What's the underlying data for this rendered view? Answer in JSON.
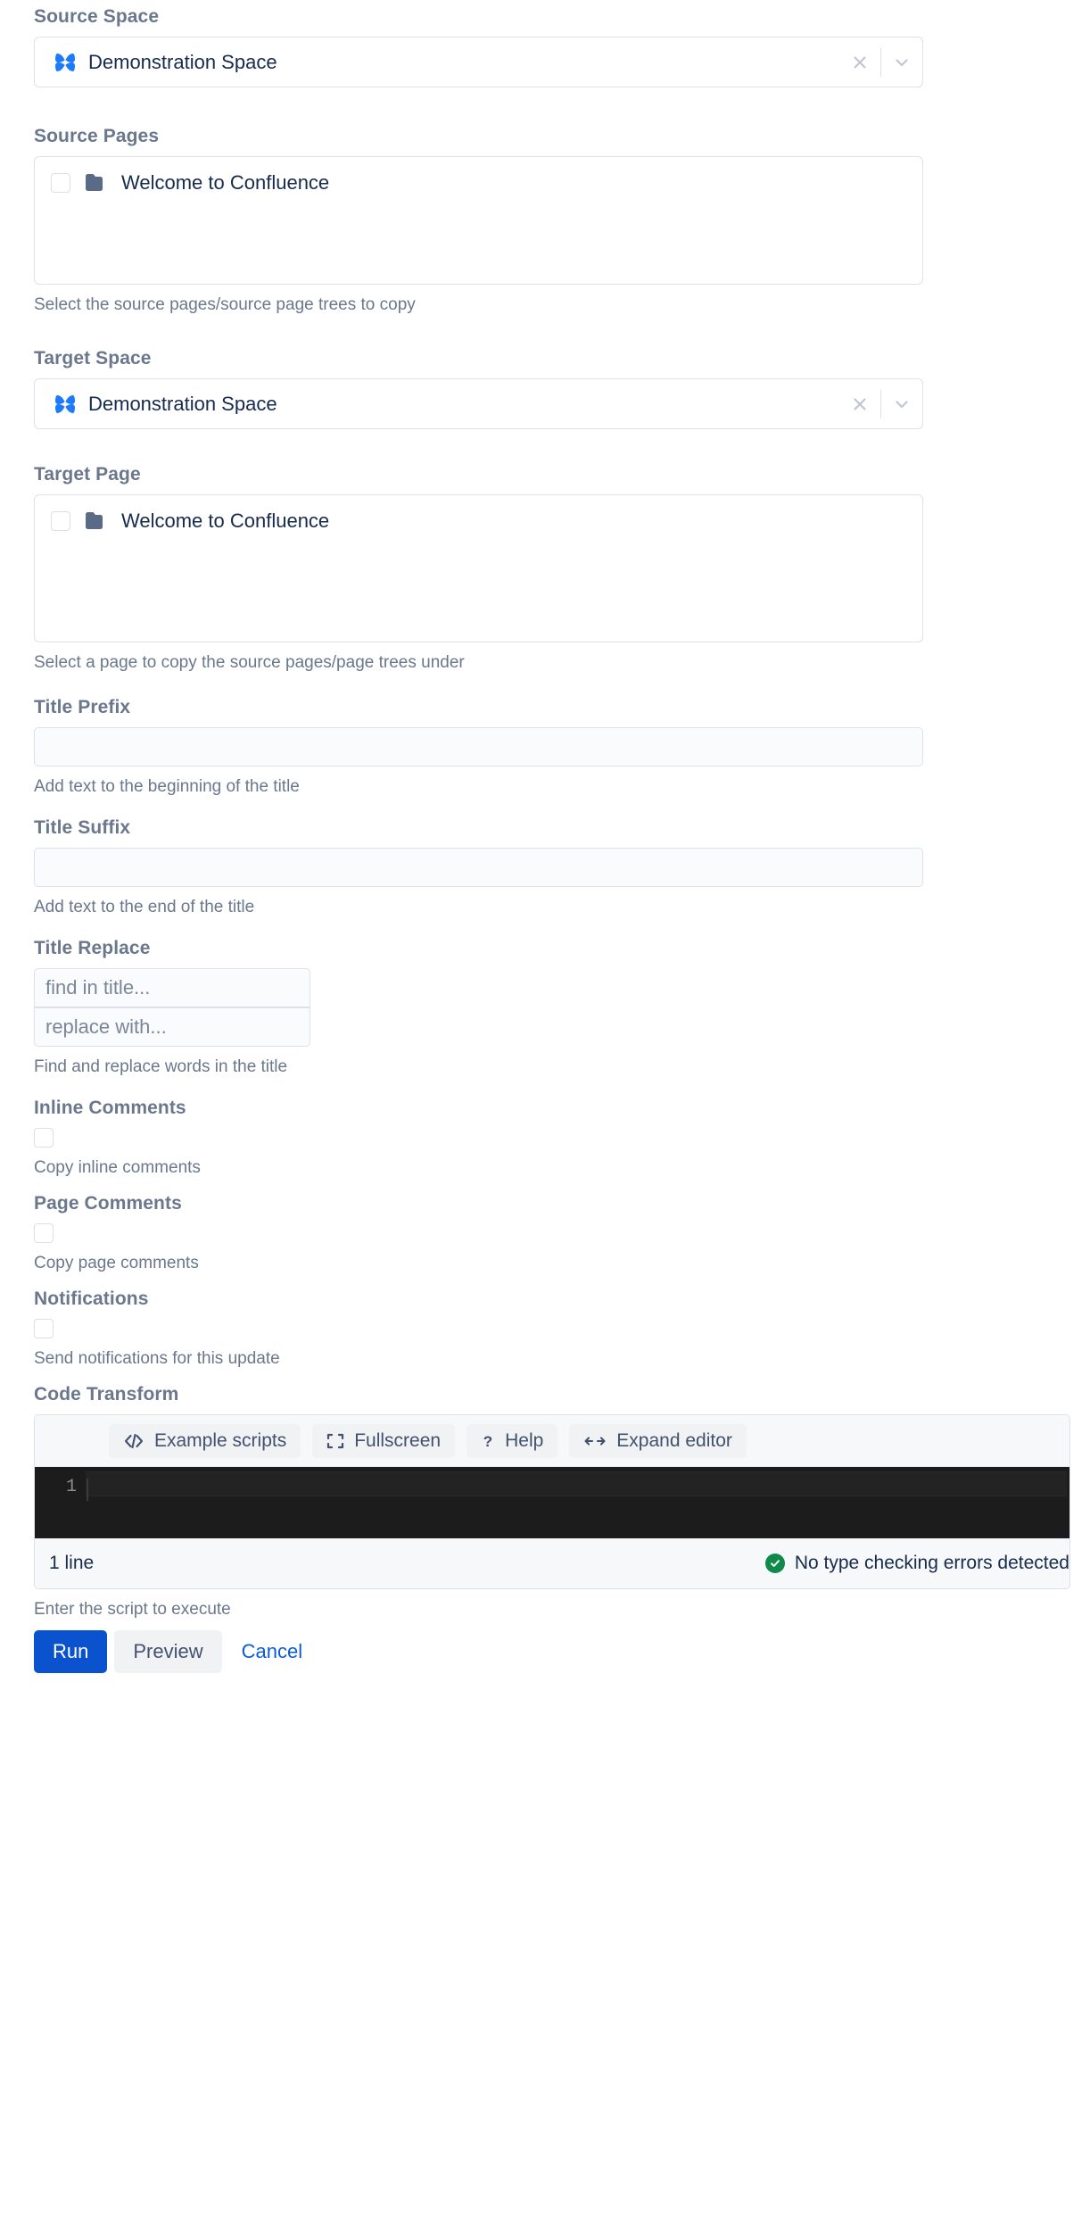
{
  "form": {
    "source_space": {
      "label": "Source Space",
      "value": "Demonstration Space",
      "icon": "space-avatar-icon",
      "clear_icon": "close-icon",
      "dropdown_icon": "chevron-down-icon"
    },
    "source_pages": {
      "label": "Source Pages",
      "help": "Select the source pages/source page trees to copy",
      "items": [
        {
          "title": "Welcome to Confluence",
          "icon": "folder-icon",
          "checked": false
        }
      ]
    },
    "target_space": {
      "label": "Target Space",
      "value": "Demonstration Space",
      "icon": "space-avatar-icon",
      "clear_icon": "close-icon",
      "dropdown_icon": "chevron-down-icon"
    },
    "target_page": {
      "label": "Target Page",
      "help": "Select a page to copy the source pages/page trees under",
      "items": [
        {
          "title": "Welcome to Confluence",
          "icon": "folder-icon",
          "checked": false
        }
      ]
    },
    "title_prefix": {
      "label": "Title Prefix",
      "value": "",
      "placeholder": "",
      "help": "Add text to the beginning of the title"
    },
    "title_suffix": {
      "label": "Title Suffix",
      "value": "",
      "placeholder": "",
      "help": "Add text to the end of the title"
    },
    "title_replace": {
      "label": "Title Replace",
      "find_value": "",
      "find_placeholder": "find in title...",
      "replace_value": "",
      "replace_placeholder": "replace with...",
      "help": "Find and replace words in the title"
    },
    "inline_comments": {
      "label": "Inline Comments",
      "help": "Copy inline comments",
      "checked": false
    },
    "page_comments": {
      "label": "Page Comments",
      "help": "Copy page comments",
      "checked": false
    },
    "notifications": {
      "label": "Notifications",
      "help": "Send notifications for this update",
      "checked": false
    },
    "code_transform": {
      "label": "Code Transform",
      "help": "Enter the script to execute",
      "toolbar": [
        {
          "label": "Example scripts",
          "icon": "code-tag-icon"
        },
        {
          "label": "Fullscreen",
          "icon": "fullscreen-icon"
        },
        {
          "label": "Help",
          "icon": "question-mark-icon"
        },
        {
          "label": "Expand editor",
          "icon": "left-right-arrows-icon"
        }
      ],
      "line_number": "1",
      "script_value": "",
      "status_left": "1 line",
      "status_right": "No type checking errors detected",
      "status_icon": "check-circle-icon"
    }
  },
  "actions": {
    "run_label": "Run",
    "preview_label": "Preview",
    "cancel_label": "Cancel"
  },
  "colors": {
    "primary": "#0b53ce",
    "link": "#0c5bd6",
    "label": "#6b778c",
    "text": "#172b4d",
    "success": "#0f8a4b",
    "space_icon": "#1d7afc",
    "folder_icon": "#5a6b87",
    "editor_bg": "#1c1c1c"
  }
}
